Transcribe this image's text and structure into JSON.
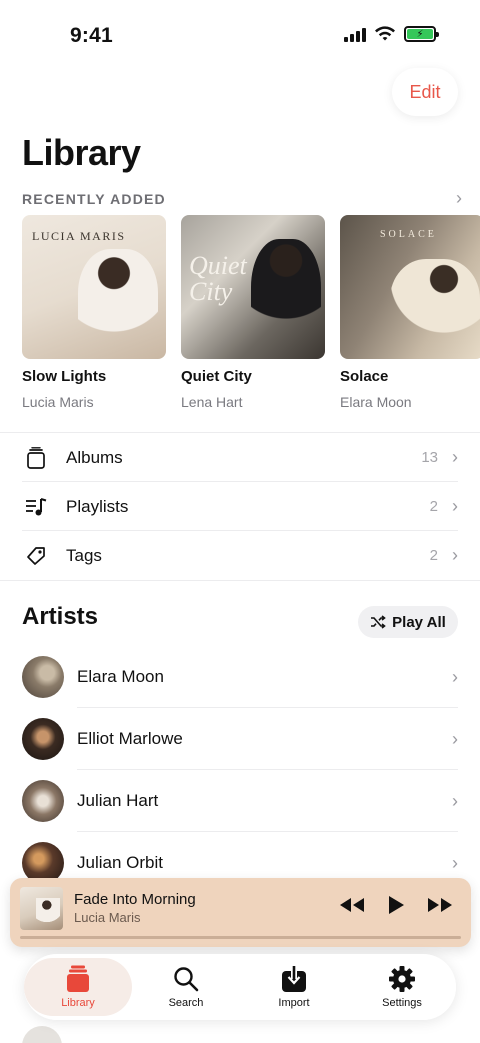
{
  "status_bar": {
    "time": "9:41"
  },
  "header": {
    "edit_label": "Edit",
    "title": "Library"
  },
  "recently_added": {
    "section_title": "RECENTLY ADDED",
    "albums": [
      {
        "title": "Slow Lights",
        "artist": "Lucia Maris",
        "cover_text": "LUCIA MARIS"
      },
      {
        "title": "Quiet City",
        "artist": "Lena Hart",
        "cover_text": "Quiet City"
      },
      {
        "title": "Solace",
        "artist": "Elara Moon",
        "cover_text": "SOLACE"
      }
    ]
  },
  "library_nav": [
    {
      "label": "Albums",
      "count": "13",
      "icon": "album-stack-icon"
    },
    {
      "label": "Playlists",
      "count": "2",
      "icon": "playlist-icon"
    },
    {
      "label": "Tags",
      "count": "2",
      "icon": "tag-icon"
    }
  ],
  "artists": {
    "section_title": "Artists",
    "play_all_label": "Play All",
    "items": [
      {
        "name": "Elara Moon"
      },
      {
        "name": "Elliot Marlowe"
      },
      {
        "name": "Julian Hart"
      },
      {
        "name": "Julian Orbit"
      }
    ]
  },
  "now_playing": {
    "title": "Fade Into Morning",
    "artist": "Lucia Maris",
    "progress": 0.0
  },
  "tab_bar": {
    "tabs": [
      {
        "label": "Library",
        "icon": "library-icon",
        "active": true
      },
      {
        "label": "Search",
        "icon": "search-icon",
        "active": false
      },
      {
        "label": "Import",
        "icon": "import-icon",
        "active": false
      },
      {
        "label": "Settings",
        "icon": "gear-icon",
        "active": false
      }
    ]
  },
  "colors": {
    "accent": "#e8574a",
    "mini_player_bg": "#efd4bd"
  }
}
